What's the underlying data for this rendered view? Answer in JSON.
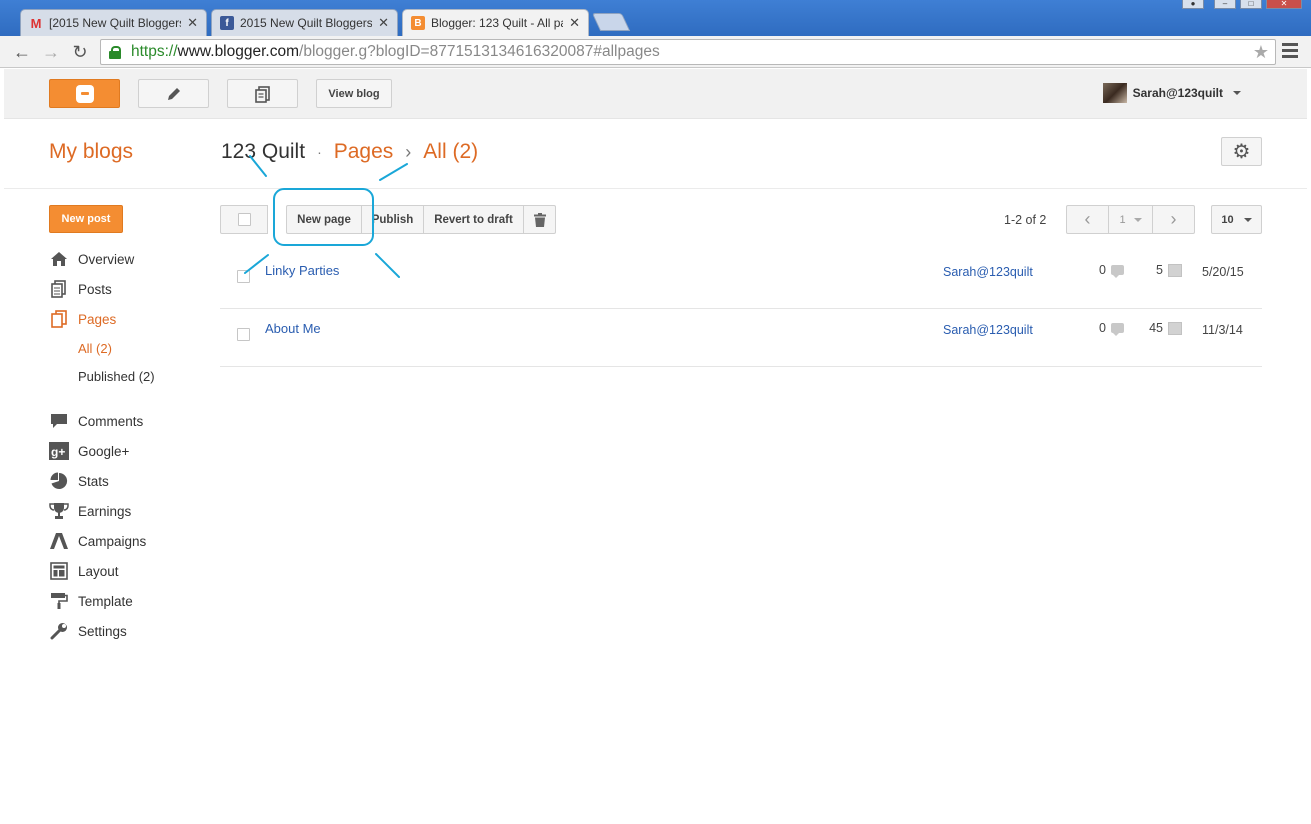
{
  "browser": {
    "tabs": [
      {
        "title": "[2015 New Quilt Bloggers] ",
        "favicon": "gmail-icon"
      },
      {
        "title": "2015 New Quilt Bloggers",
        "favicon": "facebook-icon"
      },
      {
        "title": "Blogger: 123 Quilt - All pa",
        "favicon": "blogger-icon"
      }
    ],
    "url": {
      "scheme": "https://",
      "host": "www.blogger.com",
      "path": "/blogger.g?blogID=8771513134616320087#allpages"
    }
  },
  "header": {
    "view_blog": "View blog",
    "user_name": "Sarah@123quilt"
  },
  "title_row": {
    "my_blogs": "My blogs",
    "blog_name": "123 Quilt",
    "dot": "·",
    "pages": "Pages",
    "chev": "›",
    "all": "All (2)"
  },
  "sidebar": {
    "new_post": "New post",
    "items": [
      {
        "label": "Overview",
        "icon": "home-icon"
      },
      {
        "label": "Posts",
        "icon": "posts-icon"
      },
      {
        "label": "Pages",
        "icon": "pages-icon"
      },
      {
        "label": "Comments",
        "icon": "comment-icon"
      },
      {
        "label": "Google+",
        "icon": "google-plus-icon"
      },
      {
        "label": "Stats",
        "icon": "pie-chart-icon"
      },
      {
        "label": "Earnings",
        "icon": "trophy-icon"
      },
      {
        "label": "Campaigns",
        "icon": "campaigns-icon"
      },
      {
        "label": "Layout",
        "icon": "layout-icon"
      },
      {
        "label": "Template",
        "icon": "paint-roller-icon"
      },
      {
        "label": "Settings",
        "icon": "wrench-icon"
      }
    ],
    "sub_items": [
      {
        "label": "All (2)"
      },
      {
        "label": "Published (2)"
      }
    ]
  },
  "actions": {
    "new_page": "New page",
    "publish": "Publish",
    "revert": "Revert to draft",
    "count": "1-2 of 2",
    "page": "1",
    "per_page": "10"
  },
  "rows": [
    {
      "title": "Linky Parties",
      "author": "Sarah@123quilt",
      "comments": "0",
      "views": "5",
      "date": "5/20/15"
    },
    {
      "title": "About Me",
      "author": "Sarah@123quilt",
      "comments": "0",
      "views": "45",
      "date": "11/3/14"
    }
  ],
  "colors": {
    "accent": "#dd6a24",
    "button_orange": "#f48d32",
    "link": "#2a5db0",
    "annotation": "#1aa7d8"
  }
}
